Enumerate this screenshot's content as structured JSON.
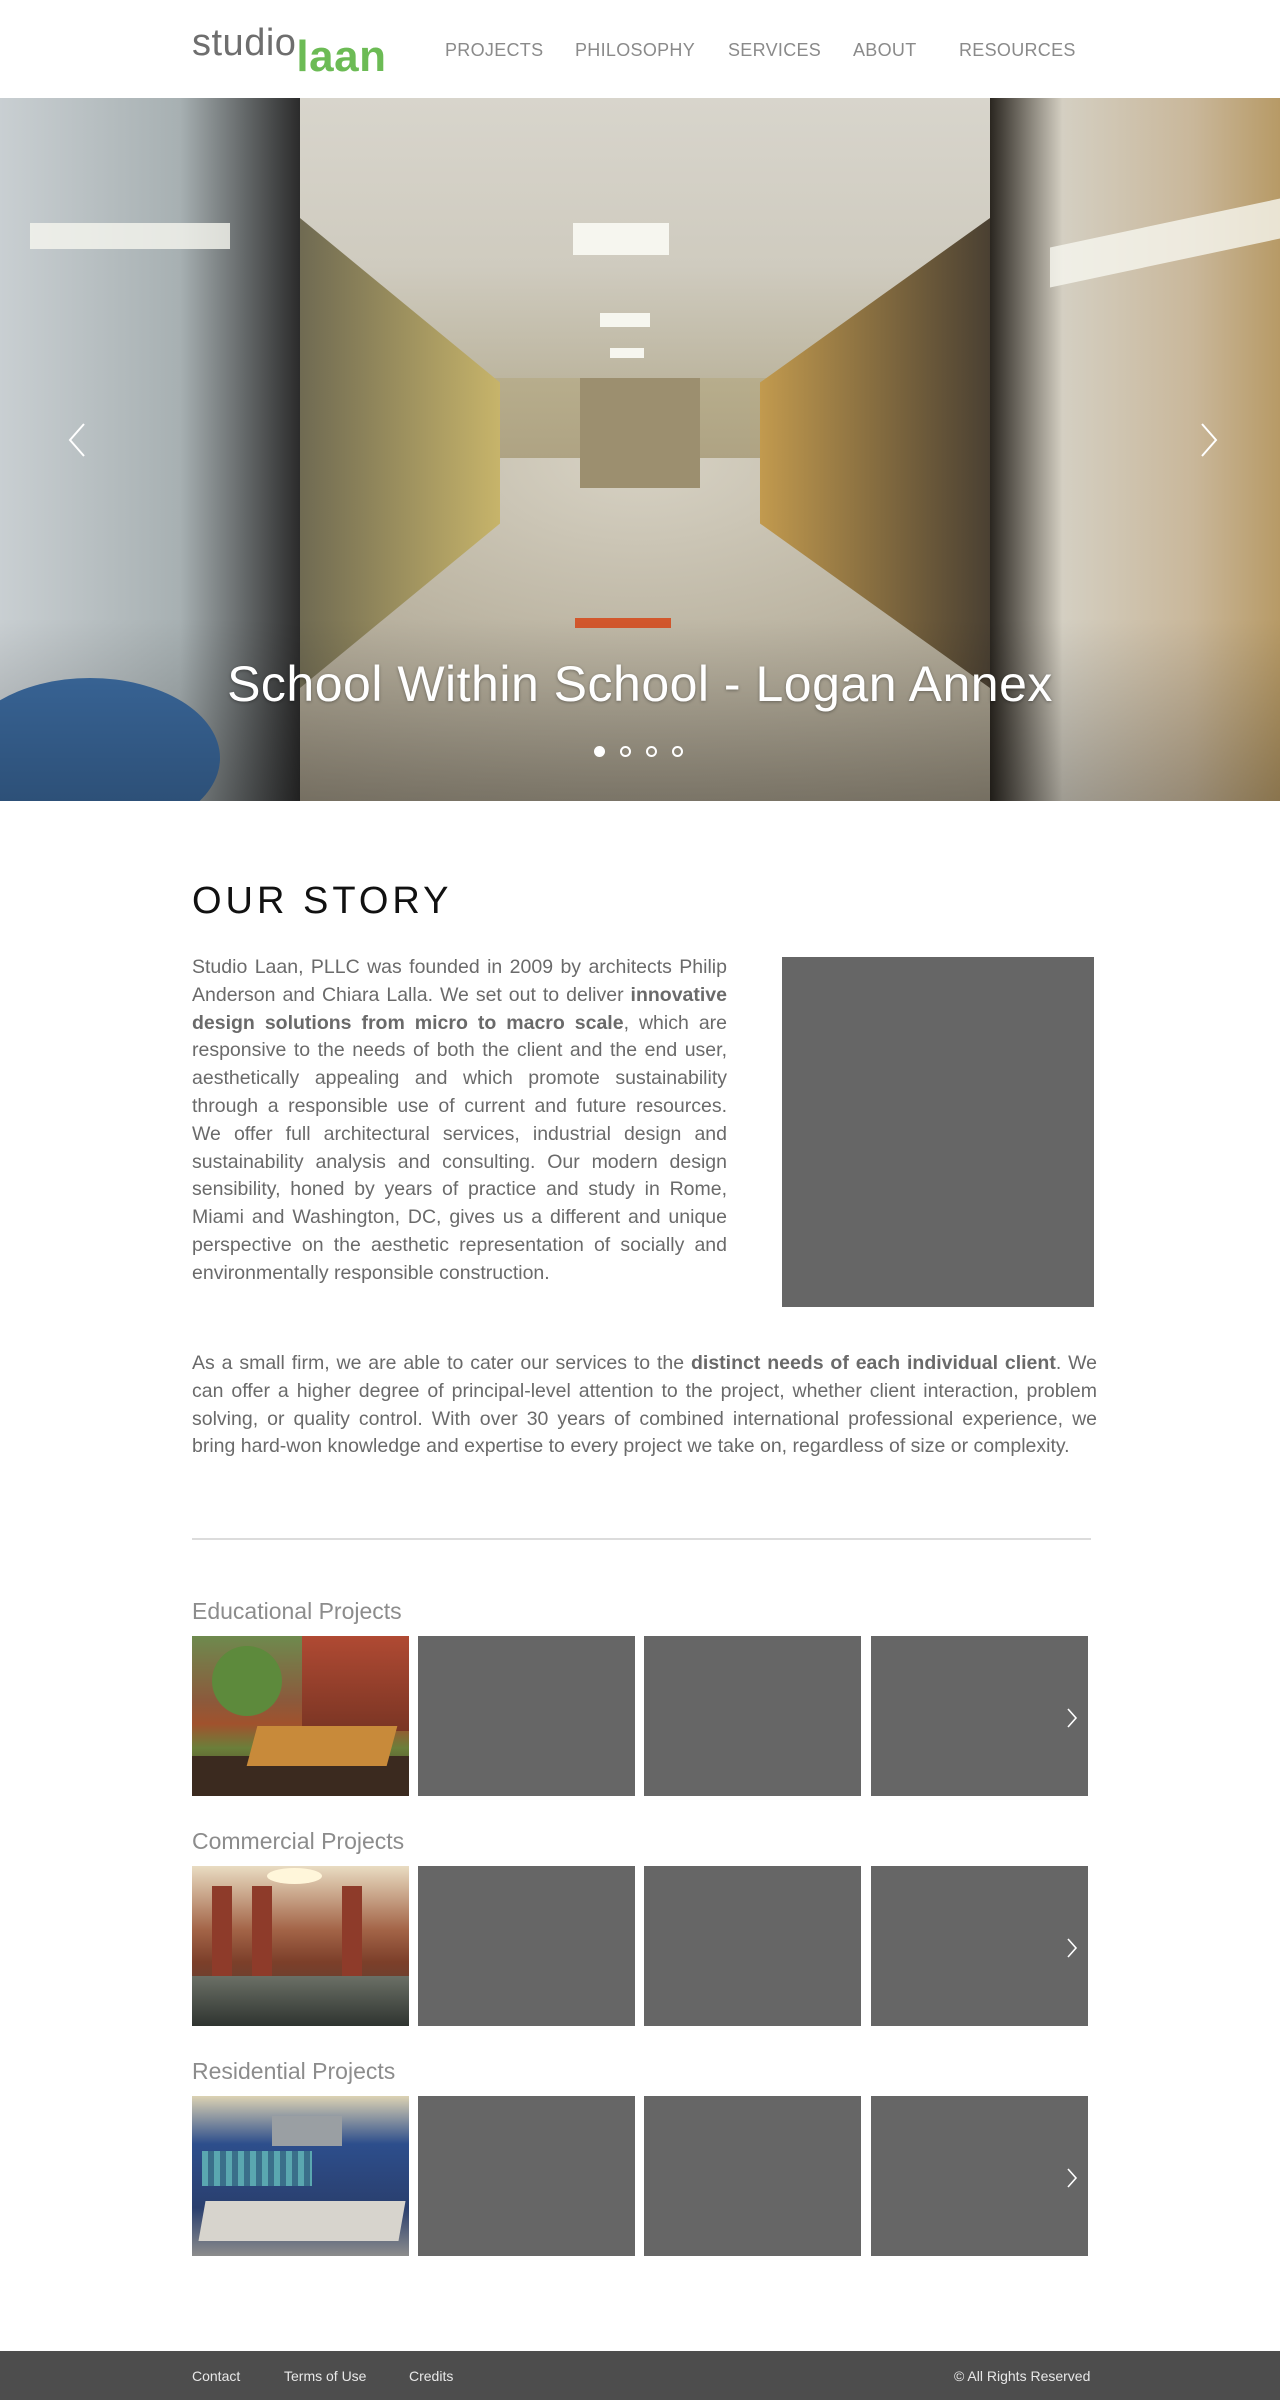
{
  "header": {
    "logo_studio": "studio",
    "logo_laan": "laan",
    "nav": [
      "PROJECTS",
      "PHILOSOPHY",
      "SERVICES",
      "ABOUT",
      "RESOURCES"
    ]
  },
  "hero": {
    "caption": "School Within School - Logan Annex",
    "slide_count": 4,
    "active_slide": 1,
    "prev_icon": "chevron-left-icon",
    "next_icon": "chevron-right-icon"
  },
  "story": {
    "title": "OUR STORY",
    "p1_a": "Studio Laan, PLLC was founded in 2009 by architects Philip Anderson and Chiara Lalla. We set out to deliver ",
    "p1_bold": "innovative design solutions from micro to macro scale",
    "p1_b": ", which are responsive to the needs of both the client and the end user, aesthetically appealing and which promote sustainability through a responsible use of current and future resources. We offer full architectural services, industrial design and sustainability analysis and consulting. Our modern design sensibility, honed by years of practice and study in Rome, Miami and Washington, DC, gives us a different and unique perspective on the aesthetic representation of socially and environmentally responsible construction.",
    "p2_a": "As a small firm, we are able to cater our services to the ",
    "p2_bold": "distinct needs of each individual client",
    "p2_b": ". We can offer a higher degree of principal-level attention to the project, whether client interaction, problem solving, or quality control. With over 30 years of combined international professional experience, we bring hard-won knowledge and expertise to every project we take on, regardless of size or complexity."
  },
  "projects": [
    {
      "title": "Educational Projects"
    },
    {
      "title": "Commercial Projects"
    },
    {
      "title": "Residential Projects"
    }
  ],
  "footer": {
    "contact": "Contact",
    "terms": "Terms of Use",
    "credits": "Credits",
    "copyright": "© All Rights Reserved"
  },
  "colors": {
    "brand_green": "#6cbb55",
    "placeholder_gray": "#666666",
    "footer_bg": "#4d4d4d"
  }
}
